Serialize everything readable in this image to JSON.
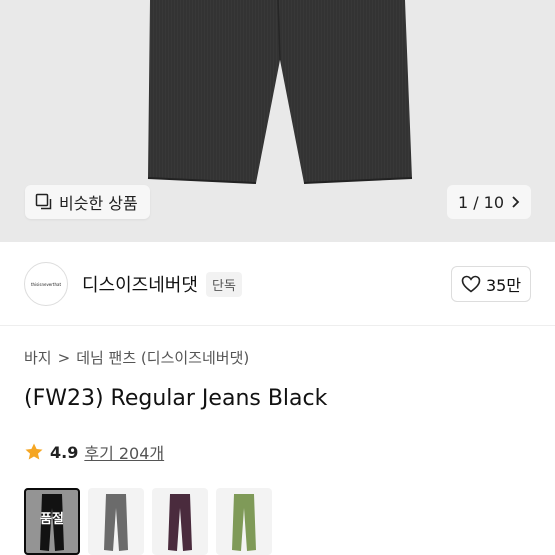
{
  "hero": {
    "similar_label": "비슷한 상품",
    "similar_icon": "copy-icon",
    "pager_text": "1 / 10",
    "pager_icon": "chevron-right-icon"
  },
  "brand": {
    "logo_text": "thisisneverthat",
    "name": "디스이즈네버댓",
    "badge": "단독",
    "like_count": "35만",
    "like_icon": "heart-icon"
  },
  "breadcrumb": {
    "items": [
      "바지",
      "데님 팬츠 (디스이즈네버댓)"
    ],
    "separator": ">"
  },
  "product": {
    "title": "(FW23) Regular Jeans Black"
  },
  "rating": {
    "star_icon": "star-icon",
    "score": "4.9",
    "reviews": "후기 204개"
  },
  "swatches": [
    {
      "color": "#1c1c1c",
      "selected": true,
      "label": "품절"
    },
    {
      "color": "#6b6b6b",
      "selected": false,
      "label": ""
    },
    {
      "color": "#4a2b3d",
      "selected": false,
      "label": ""
    },
    {
      "color": "#7f9a58",
      "selected": false,
      "label": ""
    }
  ],
  "colors": {
    "hero_bg": "#e9e9e9",
    "star": "#f5a623",
    "denim": "#2e2e2e"
  }
}
